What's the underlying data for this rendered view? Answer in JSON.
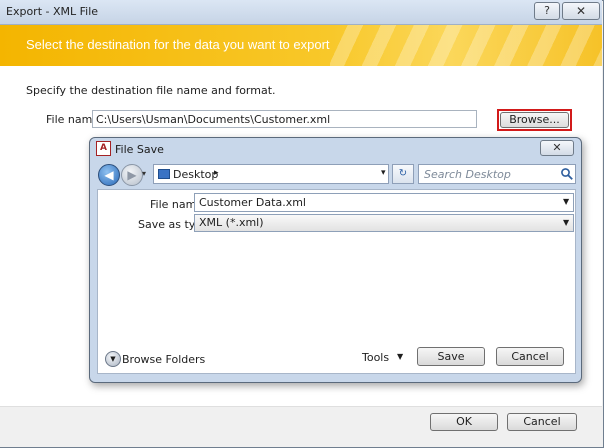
{
  "outer_window": {
    "title": "Export - XML File",
    "help_glyph": "?",
    "close_glyph": "✕",
    "banner_text": "Select the destination for the data you want to export",
    "specify_text": "Specify the destination file name and format.",
    "file_name_label": "File name:",
    "file_name_value": "C:\\Users\\Usman\\Documents\\Customer.xml",
    "browse_label": "Browse...",
    "ok_label": "OK",
    "cancel_label": "Cancel",
    "banner_color": "#f4b500",
    "highlight_color": "#d21a1a"
  },
  "file_save_dialog": {
    "title": "File Save",
    "app_icon_letter": "A",
    "close_glyph": "✕",
    "address": {
      "location": "Desktop",
      "chevron": "▸",
      "dropdown_glyph": "▾"
    },
    "refresh_glyph": "↻",
    "search_placeholder": "Search Desktop",
    "file_name_label": "File name:",
    "file_name_value": "Customer Data.xml",
    "save_as_type_label": "Save as type:",
    "save_as_type_value": "XML (*.xml)",
    "browse_folders_label": "Browse Folders",
    "tools_label": "Tools",
    "save_label": "Save",
    "cancel_label": "Cancel",
    "icons": [
      "back-arrow-icon",
      "forward-arrow-icon",
      "folder-icon",
      "refresh-icon",
      "search-icon",
      "expand-icon"
    ]
  }
}
